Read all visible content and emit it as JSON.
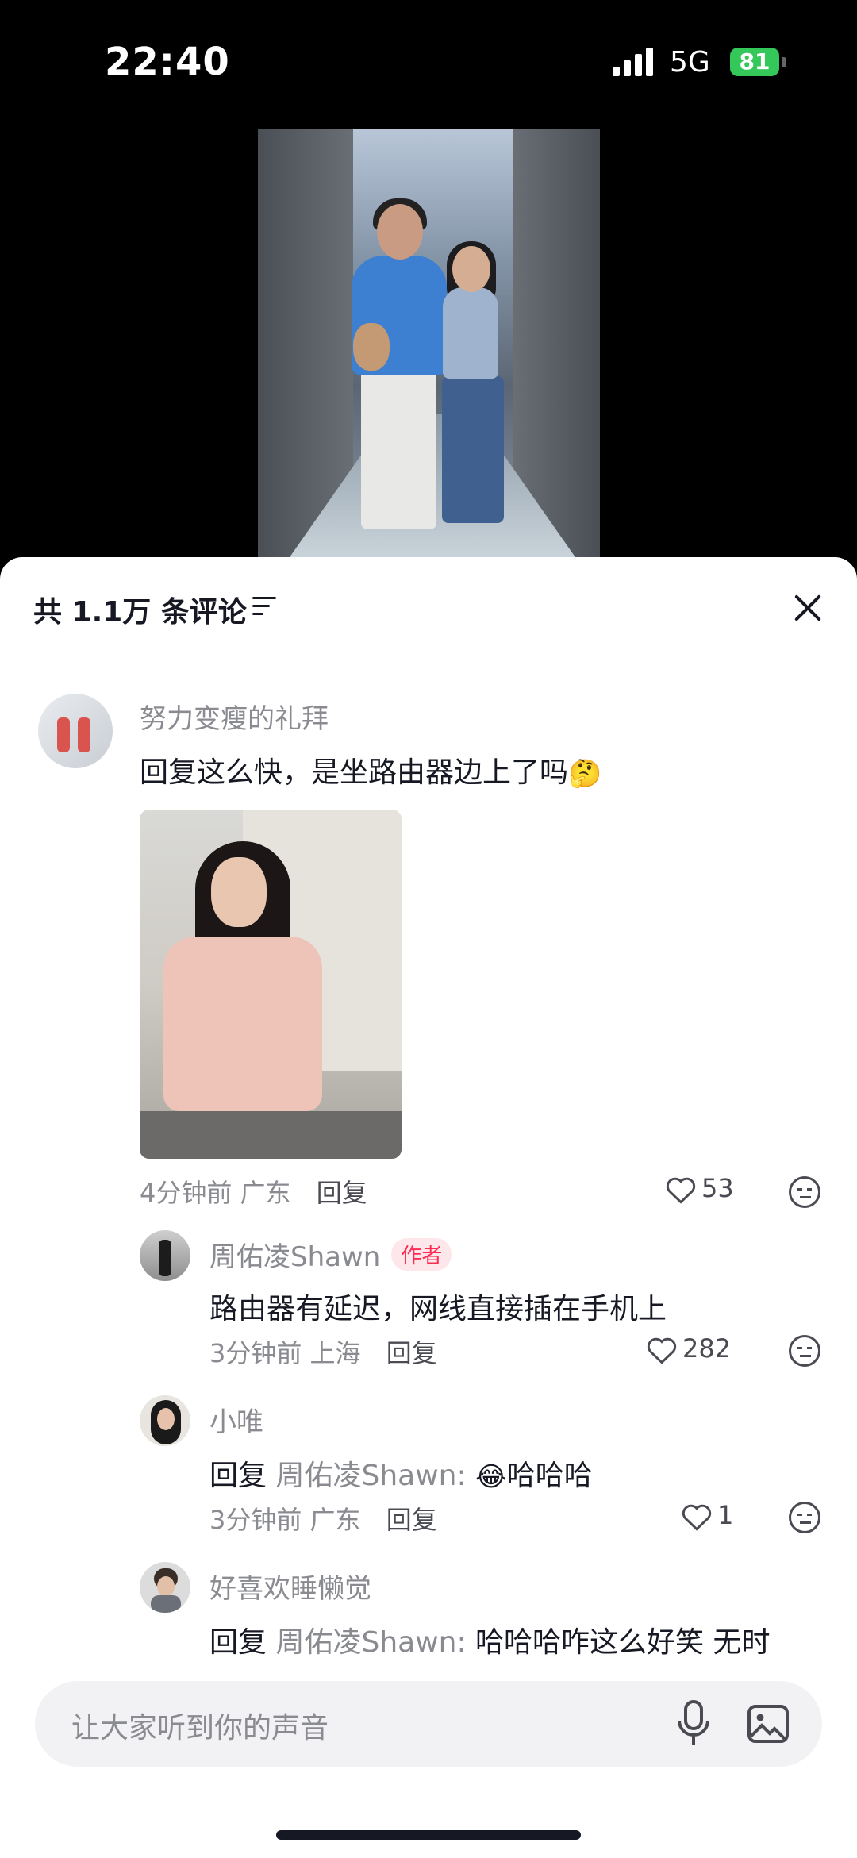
{
  "status_bar": {
    "time": "22:40",
    "network": "5G",
    "battery": "81"
  },
  "comments_panel": {
    "title": "共 1.1万 条评论",
    "input_placeholder": "让大家听到你的声音"
  },
  "comments": [
    {
      "username": "努力变瘦的礼拜",
      "text": "回复这么快，是坐路由器边上了吗",
      "emoji": "🤔",
      "time": "4分钟前",
      "location": "广东",
      "reply_label": "回复",
      "likes": "53"
    }
  ],
  "replies": [
    {
      "username": "周佑凌Shawn",
      "badge": "作者",
      "text": "路由器有延迟，网线直接插在手机上",
      "time": "3分钟前",
      "location": "上海",
      "reply_label": "回复",
      "likes": "282"
    },
    {
      "username": "小唯",
      "prefix": "回复",
      "reply_to": "周佑凌Shawn:",
      "emoji": "😂",
      "text": "哈哈哈",
      "time": "3分钟前",
      "location": "广东",
      "reply_label": "回复",
      "likes": "1"
    },
    {
      "username": "好喜欢睡懒觉",
      "prefix": "回复",
      "reply_to": "周佑凌Shawn:",
      "text": "哈哈哈咋这么好笑 无时"
    }
  ],
  "colors": {
    "accent": "#fe2c55",
    "battery": "#34c759",
    "text": "#161823",
    "secondary": "#8a8b91"
  }
}
